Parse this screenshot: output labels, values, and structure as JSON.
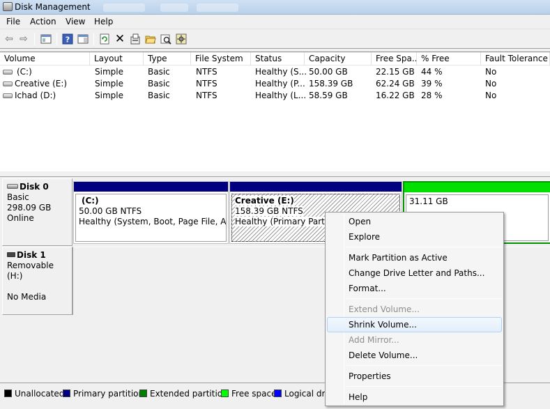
{
  "window": {
    "title": "Disk Management"
  },
  "menu": [
    "File",
    "Action",
    "View",
    "Help"
  ],
  "toolbar": {
    "icons": [
      "back-icon",
      "forward-icon",
      "console-icon",
      "help-icon",
      "pane-icon",
      "refresh-icon",
      "delete-icon",
      "properties-icon",
      "open-icon",
      "explore-icon",
      "settings-icon"
    ]
  },
  "volume_list": {
    "columns": [
      "Volume",
      "Layout",
      "Type",
      "File System",
      "Status",
      "Capacity",
      "Free Spa...",
      "% Free",
      "Fault Tolerance"
    ],
    "rows": [
      {
        "volume": "(C:)",
        "layout": "Simple",
        "type": "Basic",
        "fs": "NTFS",
        "status": "Healthy (S...",
        "capacity": "50.00 GB",
        "free": "22.15 GB",
        "pct": "44 %",
        "fault": "No"
      },
      {
        "volume": "Creative (E:)",
        "layout": "Simple",
        "type": "Basic",
        "fs": "NTFS",
        "status": "Healthy (P...",
        "capacity": "158.39 GB",
        "free": "62.24 GB",
        "pct": "39 %",
        "fault": "No"
      },
      {
        "volume": "Ichad (D:)",
        "layout": "Simple",
        "type": "Basic",
        "fs": "NTFS",
        "status": "Healthy (L...",
        "capacity": "58.59 GB",
        "free": "16.22 GB",
        "pct": "28 %",
        "fault": "No"
      }
    ]
  },
  "disks": [
    {
      "name": "Disk 0",
      "type": "Basic",
      "size": "298.09 GB",
      "state": "Online",
      "partitions": [
        {
          "title": "(C:)",
          "size": "50.00 GB NTFS",
          "status": "Healthy (System, Boot, Page File, Active"
        },
        {
          "title": "Creative  (E:)",
          "size": "158.39 GB NTFS",
          "status": "Healthy (Primary Partitio"
        },
        {
          "title": "",
          "size": "31.11 GB",
          "status": ""
        }
      ]
    },
    {
      "name": "Disk 1",
      "type": "Removable (H:)",
      "state": "No Media"
    }
  ],
  "legend": [
    {
      "label": "Unallocated",
      "color": "#000000"
    },
    {
      "label": "Primary partition",
      "color": "#000080"
    },
    {
      "label": "Extended partition",
      "color": "#008000"
    },
    {
      "label": "Free space",
      "color": "#00ff00"
    },
    {
      "label": "Logical driv",
      "color": "#0000ff"
    }
  ],
  "context_menu": {
    "items": [
      {
        "label": "Open",
        "enabled": true
      },
      {
        "label": "Explore",
        "enabled": true
      },
      {
        "label": "Mark Partition as Active",
        "enabled": true
      },
      {
        "label": "Change Drive Letter and Paths...",
        "enabled": true
      },
      {
        "label": "Format...",
        "enabled": true
      },
      {
        "label": "Extend Volume...",
        "enabled": false
      },
      {
        "label": "Shrink Volume...",
        "enabled": true,
        "highlighted": true
      },
      {
        "label": "Add Mirror...",
        "enabled": false
      },
      {
        "label": "Delete Volume...",
        "enabled": true
      },
      {
        "label": "Properties",
        "enabled": true
      },
      {
        "label": "Help",
        "enabled": true
      }
    ]
  },
  "colors": {
    "primary": "#000080",
    "free": "#00ff00",
    "highlight": "#aecff7"
  }
}
